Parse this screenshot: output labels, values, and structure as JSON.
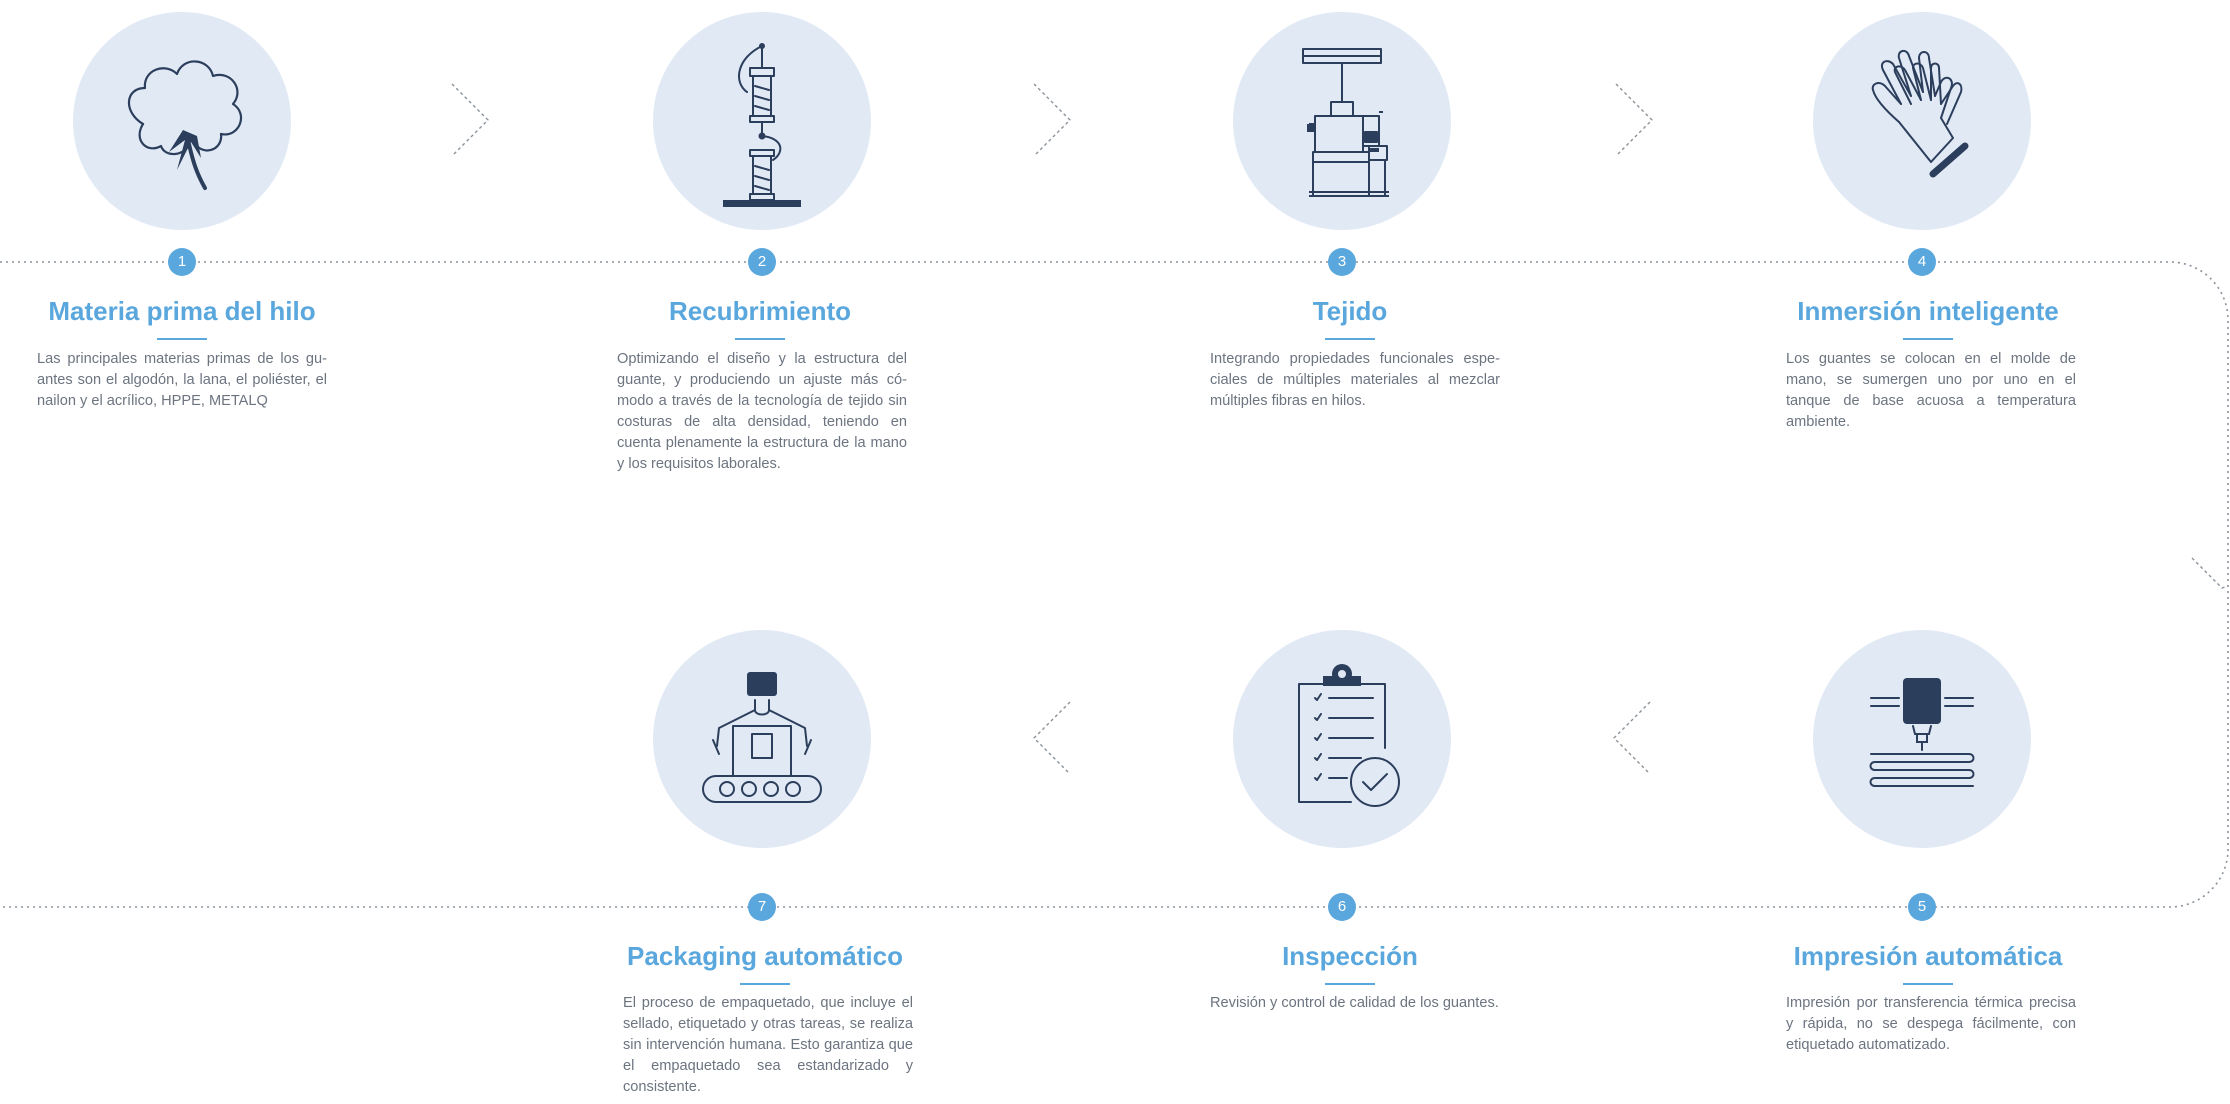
{
  "steps": [
    {
      "number": "1",
      "title": "Materia prima del hilo",
      "icon": "cotton-icon",
      "description": "Las principales materias primas de los gu­antes son el algodón, la lana, el poliéster, el nailon y el acrílico, HPPE, METALQ"
    },
    {
      "number": "2",
      "title": "Recubrimiento",
      "icon": "yarn-spool-icon",
      "description": "Optimizando el diseño y la estructura del guante, y produciendo un ajuste más có­modo a través de la tecnología de tejido sin costuras de alta densidad, teniendo en cuenta plenamente la estructura de la mano y los requisitos laborales."
    },
    {
      "number": "3",
      "title": "Tejido",
      "icon": "knitting-machine-icon",
      "description": "Integrando propiedades funcionales espe­ciales de múltiples materiales al mezclar múltiples fibras en hilos."
    },
    {
      "number": "4",
      "title": "Inmersión inteligente",
      "icon": "glove-icon",
      "description": "Los guantes se colocan en el molde de mano, se sumergen uno por uno en el tanque de base acuosa a temperatura ambiente."
    },
    {
      "number": "5",
      "title": "Impresión automática",
      "icon": "heat-transfer-printer-icon",
      "description": "Impresión por transferencia térmica pre­cisa y rápida, no se despega fácilmente, con etiquetado automatizado."
    },
    {
      "number": "6",
      "title": "Inspección",
      "icon": "clipboard-checklist-icon",
      "description": "Revisión y control de calidad de los guan­tes."
    },
    {
      "number": "7",
      "title": "Packaging automático",
      "icon": "robot-packaging-icon",
      "description": "El proceso de empaquetado, que incluye el sellado, etiquetado y otras tareas, se realiza sin intervención humana. Esto ga­rantiza que el empaquetado sea estanda­rizado y consistente."
    }
  ],
  "colors": {
    "accent": "#5aa7dd",
    "circle": "#e1e9f5",
    "icon": "#2b3e5c",
    "text": "#6c7480",
    "dotted": "#8a929c"
  }
}
